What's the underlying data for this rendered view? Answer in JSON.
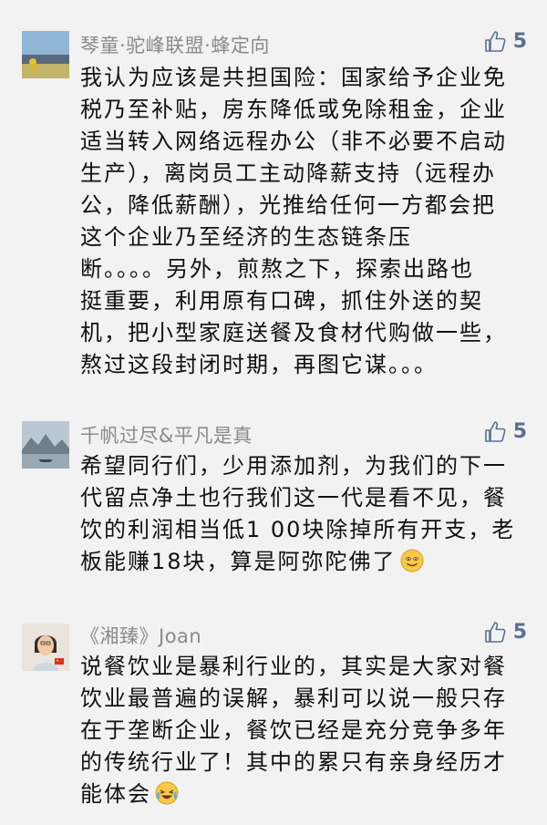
{
  "comments": [
    {
      "author": "琴童·驼峰联盟·蜂定向",
      "likes": "5",
      "lines": [
        "我认为应该是共担国险：国家给予企业免",
        "税乃至补贴，房东降低或免除租金，企业",
        "适当转入网络远程办公（非不必要不启动",
        "生产），离岗员工主动降薪支持（远程办",
        "公，降低薪酬），光推给任何一方都会把",
        "这个企业乃至经济的生态链条压",
        "断。。。。另外，煎熬之下，探索出路也",
        "挺重要，利用原有口碑，抓住外送的契",
        "机，把小型家庭送餐及食材代购做一些，",
        "熬过这段封闭时期，再图它谋。。。"
      ]
    },
    {
      "author": "千帆过尽&平凡是真",
      "likes": "5",
      "lines": [
        "希望同行们，少用添加剂，为我们的下一",
        "代留点净土也行我们这一代是看不见，餐",
        "饮的利润相当低1 00块除掉所有开支，老",
        "板能赚18块，算是阿弥陀佛了"
      ],
      "trailing_emoji": "smiling-face-icon"
    },
    {
      "author": "《湘臻》Joan",
      "likes": "5",
      "lines": [
        "说餐饮业是暴利行业的，其实是大家对餐",
        "饮业最普遍的误解，暴利可以说一般只存",
        "在于垄断企业，餐饮已经是充分竞争多年",
        "的传统行业了！其中的累只有亲身经历才",
        "能体会"
      ],
      "trailing_emoji": "crying-laughing-face-icon"
    }
  ],
  "colors": {
    "background": "#f2f2f2",
    "author": "#8a8a8a",
    "text": "#111111",
    "like": "#5a6f92"
  }
}
